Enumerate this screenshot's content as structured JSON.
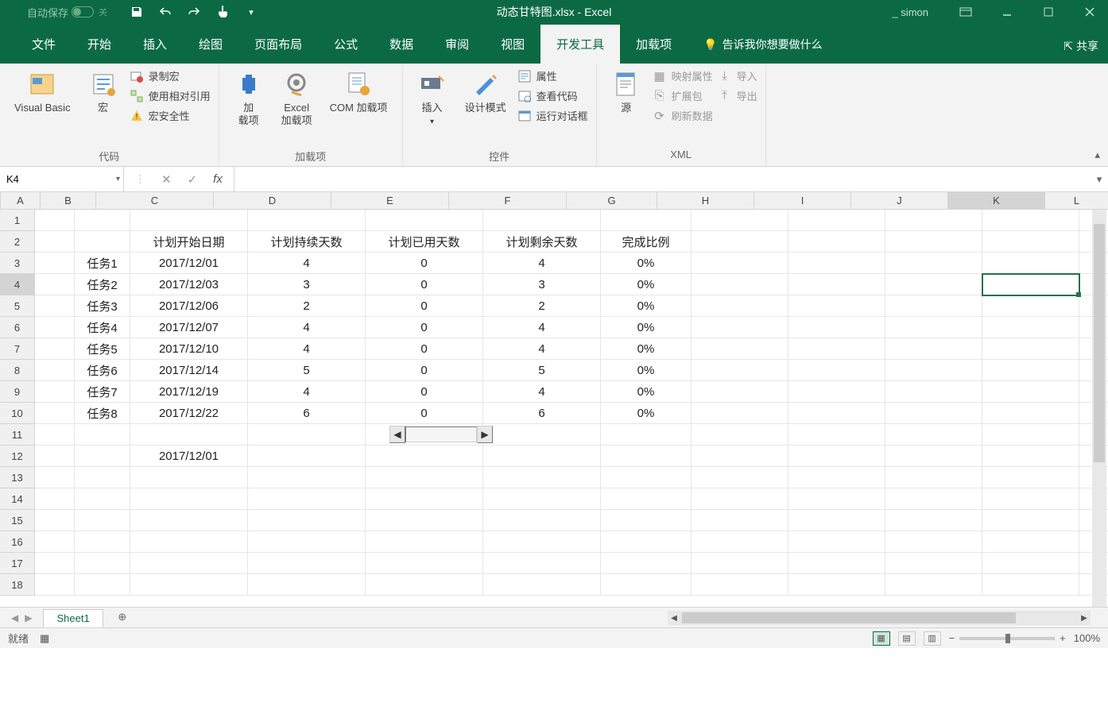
{
  "titlebar": {
    "autosave_label": "自动保存",
    "autosave_state": "关",
    "title": "动态甘特图.xlsx - Excel",
    "user": "_ simon"
  },
  "tabs": {
    "file": "文件",
    "home": "开始",
    "insert": "插入",
    "draw": "绘图",
    "layout": "页面布局",
    "formulas": "公式",
    "data": "数据",
    "review": "审阅",
    "view": "视图",
    "developer": "开发工具",
    "addins": "加载项",
    "tellme": "告诉我你想要做什么",
    "share": "共享"
  },
  "ribbon": {
    "code": {
      "visual_basic": "Visual Basic",
      "macros": "宏",
      "record_macro": "录制宏",
      "relative_ref": "使用相对引用",
      "macro_security": "宏安全性",
      "group_label": "代码"
    },
    "addins": {
      "addins": "加\n载项",
      "excel_addins": "Excel\n加载项",
      "com_addins": "COM 加载项",
      "group_label": "加载项"
    },
    "controls": {
      "insert": "插入",
      "design_mode": "设计模式",
      "properties": "属性",
      "view_code": "查看代码",
      "run_dialog": "运行对话框",
      "group_label": "控件"
    },
    "xml": {
      "source": "源",
      "map_props": "映射属性",
      "expansion": "扩展包",
      "refresh": "刷新数据",
      "import": "导入",
      "export": "导出",
      "group_label": "XML"
    }
  },
  "formulabar": {
    "namebox": "K4",
    "fx": "fx",
    "value": ""
  },
  "columns": [
    "A",
    "B",
    "C",
    "D",
    "E",
    "F",
    "G",
    "H",
    "I",
    "J",
    "K",
    "L"
  ],
  "row_count": 18,
  "active_cell": {
    "col": "K",
    "row": 4
  },
  "sheet_data": {
    "headers_row": 2,
    "headers": {
      "C": "计划开始日期",
      "D": "计划持续天数",
      "E": "计划已用天数",
      "F": "计划剩余天数",
      "G": "完成比例"
    },
    "rows": [
      {
        "r": 3,
        "B": "任务1",
        "C": "2017/12/01",
        "D": "4",
        "E": "0",
        "F": "4",
        "G": "0%"
      },
      {
        "r": 4,
        "B": "任务2",
        "C": "2017/12/03",
        "D": "3",
        "E": "0",
        "F": "3",
        "G": "0%"
      },
      {
        "r": 5,
        "B": "任务3",
        "C": "2017/12/06",
        "D": "2",
        "E": "0",
        "F": "2",
        "G": "0%"
      },
      {
        "r": 6,
        "B": "任务4",
        "C": "2017/12/07",
        "D": "4",
        "E": "0",
        "F": "4",
        "G": "0%"
      },
      {
        "r": 7,
        "B": "任务5",
        "C": "2017/12/10",
        "D": "4",
        "E": "0",
        "F": "4",
        "G": "0%"
      },
      {
        "r": 8,
        "B": "任务6",
        "C": "2017/12/14",
        "D": "5",
        "E": "0",
        "F": "5",
        "G": "0%"
      },
      {
        "r": 9,
        "B": "任务7",
        "C": "2017/12/19",
        "D": "4",
        "E": "0",
        "F": "4",
        "G": "0%"
      },
      {
        "r": 10,
        "B": "任务8",
        "C": "2017/12/22",
        "D": "6",
        "E": "0",
        "F": "6",
        "G": "0%"
      }
    ],
    "c12": "2017/12/01"
  },
  "sheettabs": {
    "active": "Sheet1"
  },
  "statusbar": {
    "ready": "就绪",
    "zoom": "100%"
  }
}
